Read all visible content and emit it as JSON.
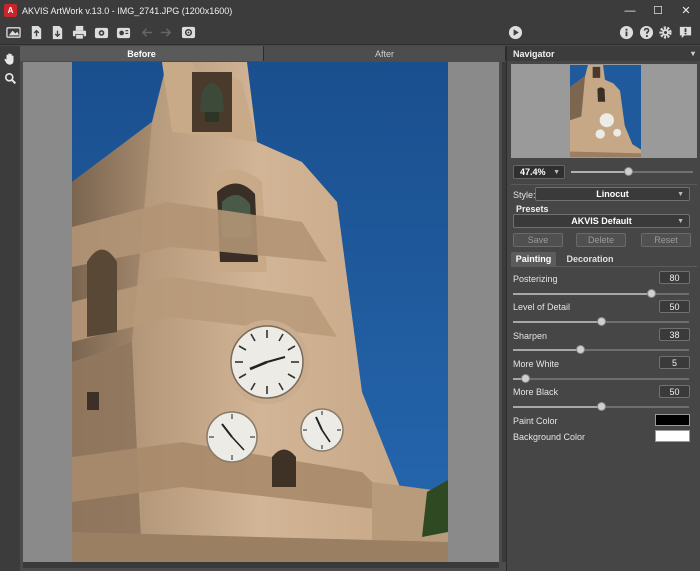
{
  "window": {
    "title": "AKVIS ArtWork v.13.0 - IMG_2741.JPG (1200x1600)",
    "logo_letter": "A",
    "controls": [
      "—",
      "☐",
      "✕"
    ]
  },
  "toolbar": {
    "icons": [
      "open-image-icon",
      "export-icon",
      "save-icon",
      "print-icon",
      "batch-icon",
      "plugin-icon",
      "undo-icon",
      "redo-icon",
      "preferences-icon",
      "run-icon",
      "info-icon",
      "help-icon",
      "settings-icon",
      "news-icon"
    ]
  },
  "tools": [
    "hand-icon",
    "zoom-icon"
  ],
  "canvas": {
    "tabs": [
      {
        "label": "Before",
        "active": true
      },
      {
        "label": "After",
        "active": false
      }
    ]
  },
  "navigator": {
    "title": "Navigator",
    "collapse_glyph": "▾"
  },
  "zoom": {
    "value": "47.4%",
    "level": 0.47
  },
  "style": {
    "label": "Style:",
    "value": "Linocut"
  },
  "presets": {
    "title": "Presets",
    "value": "AKVIS Default",
    "buttons": [
      "Save",
      "Delete",
      "Reset"
    ]
  },
  "param_tabs": [
    {
      "label": "Painting",
      "active": true
    },
    {
      "label": "Decoration",
      "active": false
    }
  ],
  "params": [
    {
      "label": "Posterizing",
      "value": "80",
      "level": 0.8
    },
    {
      "label": "Level of Detail",
      "value": "50",
      "level": 0.5
    },
    {
      "label": "Sharpen",
      "value": "38",
      "level": 0.38
    },
    {
      "label": "More White",
      "value": "5",
      "level": 0.05
    },
    {
      "label": "More Black",
      "value": "50",
      "level": 0.5
    }
  ],
  "colors": {
    "paint_label": "Paint Color",
    "paint_color": "#000000",
    "background_label": "Background Color",
    "background_color": "#ffffff"
  }
}
